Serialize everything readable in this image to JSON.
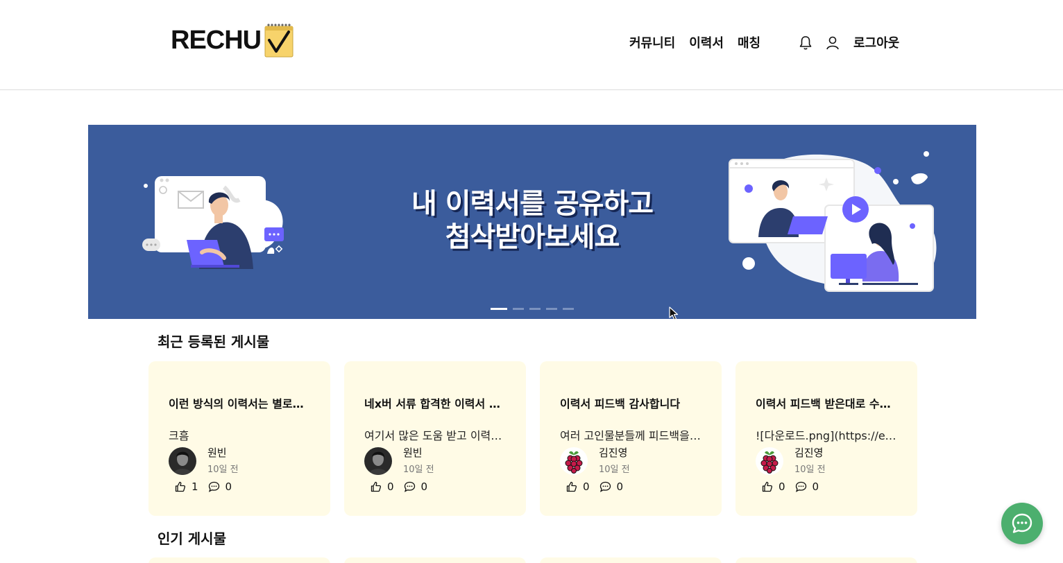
{
  "header": {
    "logo_text": "RECHU",
    "nav": [
      "커뮤니티",
      "이력서",
      "매칭"
    ],
    "icons": [
      "bell-icon",
      "user-icon"
    ],
    "logout_label": "로그아웃"
  },
  "banner": {
    "title_line1": "내 이력서를 공유하고",
    "title_line2": "첨삭받아보세요",
    "slide_count": 5,
    "active_slide": 1,
    "colors": {
      "background": "#3b5c9c"
    }
  },
  "recent": {
    "section_title": "최근 등록된 게시물",
    "posts": [
      {
        "title": "이런 방식의 이력서는 별로인가요?",
        "excerpt": "크흠",
        "author": "원빈",
        "time": "10일 전",
        "likes": "1",
        "comments": "0",
        "avatar": "photo"
      },
      {
        "title": "네x버 서류 합격한 이력서 공유합니다",
        "excerpt": "여기서 많은 도움 받고 이력서를 고쳤어요",
        "author": "원빈",
        "time": "10일 전",
        "likes": "0",
        "comments": "0",
        "avatar": "photo"
      },
      {
        "title": "이력서 피드백 감사합니다",
        "excerpt": "여러 고인물분들께 피드백을 받았습니다",
        "author": "김진영",
        "time": "10일 전",
        "likes": "0",
        "comments": "0",
        "avatar": "raspberry"
      },
      {
        "title": "이력서 피드백 받은대로 수정했습니다",
        "excerpt": "![다운로드.png](https://example)",
        "author": "김진영",
        "time": "10일 전",
        "likes": "0",
        "comments": "0",
        "avatar": "raspberry"
      }
    ]
  },
  "popular": {
    "section_title": "인기 게시물"
  },
  "theme": {
    "card_background": "#fffbe6",
    "chat_button": "#4caf6e"
  }
}
